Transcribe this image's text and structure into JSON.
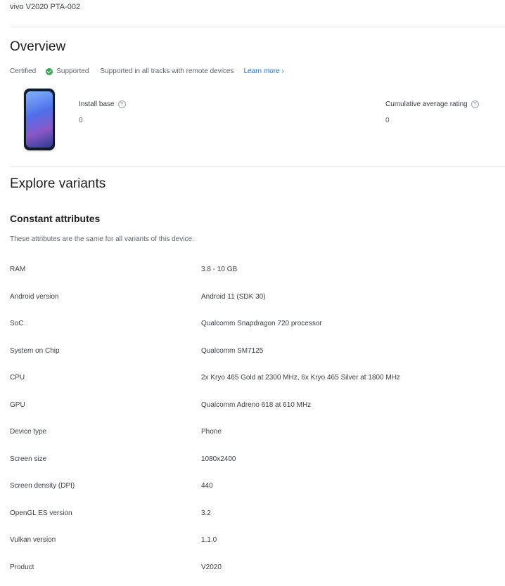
{
  "device": {
    "title": "vivo V2020 PTA-002"
  },
  "overview": {
    "heading": "Overview",
    "status_label": "Certified",
    "status_badge": "Supported",
    "status_desc": "Supported in all tracks with remote devices",
    "learn_more": "Learn more",
    "stats": [
      {
        "label": "Install base",
        "value": "0"
      },
      {
        "label": "Cumulative average rating",
        "value": "0"
      }
    ]
  },
  "explore": {
    "heading": "Explore variants",
    "constant_heading": "Constant attributes",
    "constant_subtitle": "These attributes are the same for all variants of this device.",
    "attributes": [
      {
        "key": "RAM",
        "value": "3.8 - 10 GB"
      },
      {
        "key": "Android version",
        "value": "Android 11 (SDK 30)"
      },
      {
        "key": "SoC",
        "value": "Qualcomm Snapdragon 720 processor"
      },
      {
        "key": "System on Chip",
        "value": "Qualcomm SM7125"
      },
      {
        "key": "CPU",
        "value": "2x Kryo 465 Gold at 2300 MHz, 6x Kryo 465 Silver at 1800 MHz"
      },
      {
        "key": "GPU",
        "value": "Qualcomm Adreno 618 at 610 MHz"
      },
      {
        "key": "Device type",
        "value": "Phone"
      },
      {
        "key": "Screen size",
        "value": "1080x2400"
      },
      {
        "key": "Screen density (DPI)",
        "value": "440"
      },
      {
        "key": "OpenGL ES version",
        "value": "3.2"
      },
      {
        "key": "Vulkan version",
        "value": "1.1.0"
      },
      {
        "key": "Product",
        "value": "V2020"
      }
    ]
  }
}
